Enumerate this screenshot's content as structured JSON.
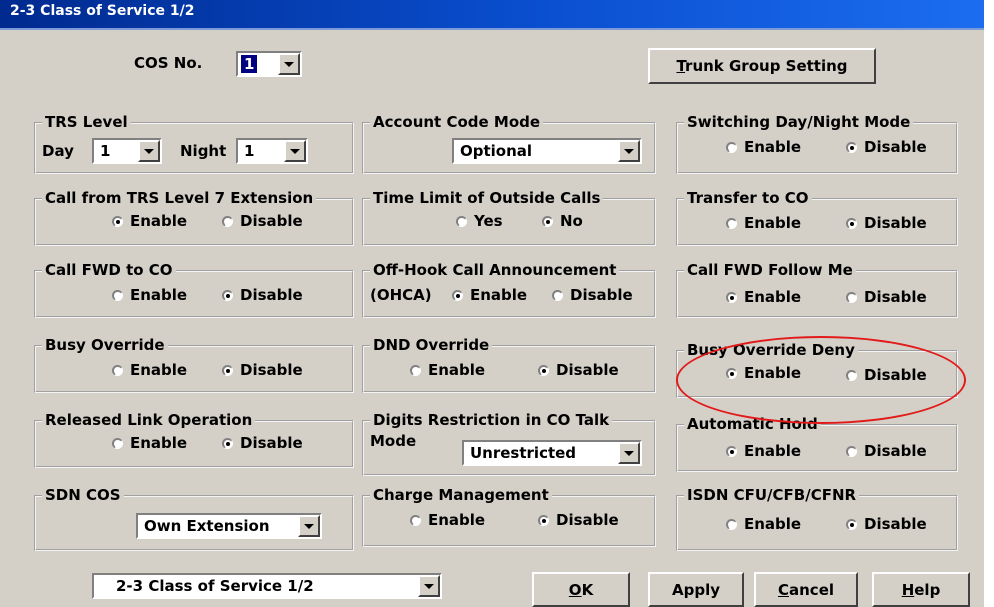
{
  "window": {
    "title": "2-3 Class of Service 1/2"
  },
  "cos": {
    "label": "COS No.",
    "value": "1"
  },
  "trunk_button": {
    "mnemonic": "T",
    "rest": "runk Group Setting"
  },
  "trs_level": {
    "title": "TRS Level",
    "day_label": "Day",
    "day_value": "1",
    "night_label": "Night",
    "night_value": "1"
  },
  "account_code": {
    "title": "Account Code Mode",
    "value": "Optional"
  },
  "switching_day_night": {
    "title": "Switching Day/Night Mode",
    "enable": "Enable",
    "disable": "Disable",
    "selected": "disable"
  },
  "call_from_trs7": {
    "title": "Call from TRS Level 7 Extension",
    "enable": "Enable",
    "disable": "Disable",
    "selected": "enable"
  },
  "time_limit": {
    "title": "Time Limit of Outside Calls",
    "yes": "Yes",
    "no": "No",
    "selected": "no"
  },
  "transfer_co": {
    "title": "Transfer to CO",
    "enable": "Enable",
    "disable": "Disable",
    "selected": "disable"
  },
  "call_fwd_co": {
    "title": "Call FWD to CO",
    "enable": "Enable",
    "disable": "Disable",
    "selected": "disable"
  },
  "ohca": {
    "title": "Off-Hook Call Announcement",
    "prefix": "(OHCA)",
    "enable": "Enable",
    "disable": "Disable",
    "selected": "enable"
  },
  "call_fwd_follow": {
    "title": "Call FWD Follow Me",
    "enable": "Enable",
    "disable": "Disable",
    "selected": "enable"
  },
  "busy_override": {
    "title": "Busy Override",
    "enable": "Enable",
    "disable": "Disable",
    "selected": "disable"
  },
  "dnd_override": {
    "title": "DND Override",
    "enable": "Enable",
    "disable": "Disable",
    "selected": "disable"
  },
  "busy_override_deny": {
    "title": "Busy Override Deny",
    "enable": "Enable",
    "disable": "Disable",
    "selected": "enable"
  },
  "released_link": {
    "title": "Released Link Operation",
    "enable": "Enable",
    "disable": "Disable",
    "selected": "disable"
  },
  "digits_restriction": {
    "title": "Digits Restriction in CO Talk",
    "mode_label": "Mode",
    "value": "Unrestricted"
  },
  "automatic_hold": {
    "title": "Automatic Hold",
    "enable": "Enable",
    "disable": "Disable",
    "selected": "enable"
  },
  "sdn_cos": {
    "title": "SDN COS",
    "value": "Own Extension"
  },
  "charge_management": {
    "title": "Charge Management",
    "enable": "Enable",
    "disable": "Disable",
    "selected": "disable"
  },
  "isdn_cfu": {
    "title": "ISDN CFU/CFB/CFNR",
    "enable": "Enable",
    "disable": "Disable",
    "selected": "disable"
  },
  "footer": {
    "page_select": "2-3 Class of Service 1/2",
    "ok": {
      "mnemonic": "O",
      "rest": "K"
    },
    "apply": "Apply",
    "cancel": {
      "mnemonic": "C",
      "rest": "ancel"
    },
    "help": {
      "mnemonic": "H",
      "rest": "elp"
    }
  },
  "colors": {
    "title_bar": "#0a4fd0",
    "face": "#d4d0c8",
    "highlight_annotation": "#e21a1a"
  }
}
